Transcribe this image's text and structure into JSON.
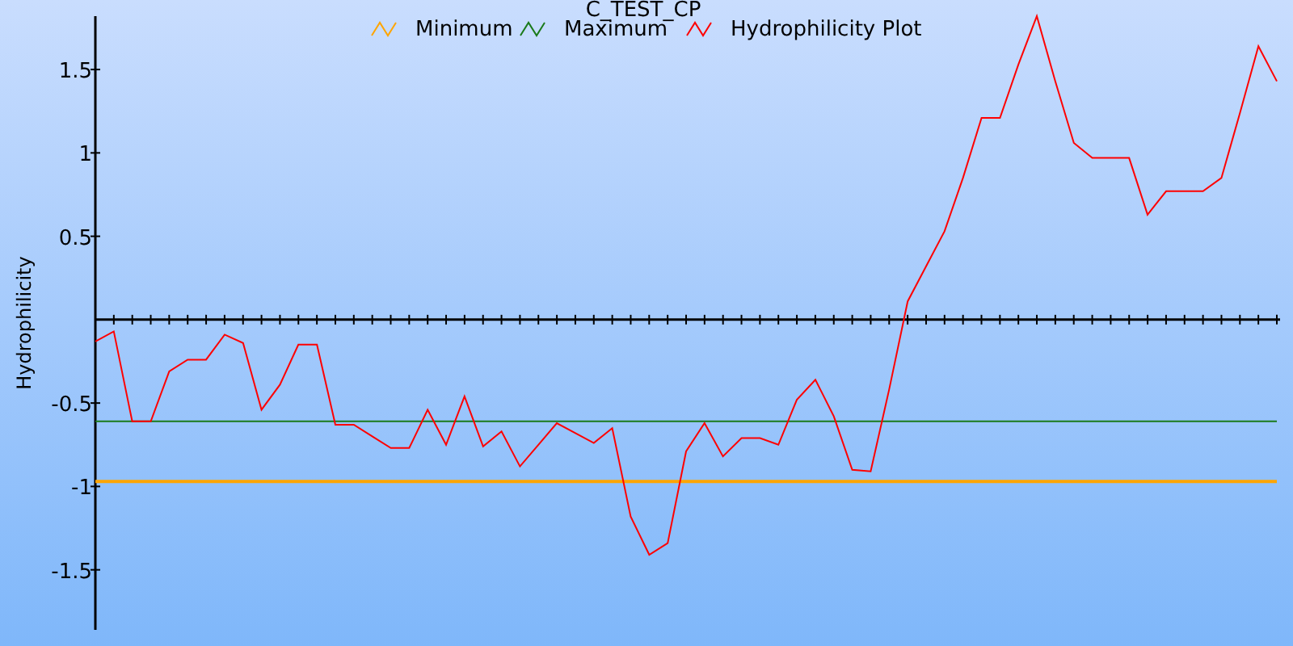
{
  "chart_data": {
    "type": "line",
    "title": "C_TEST_CP",
    "ylabel": "Hydrophilicity",
    "categories": [
      null,
      null,
      null,
      null,
      null,
      null,
      null,
      null,
      null,
      null,
      null,
      null,
      null,
      null,
      null,
      null,
      null,
      null,
      null,
      null,
      null,
      null,
      null,
      null,
      null,
      null,
      null,
      null,
      null,
      null,
      null,
      null,
      null,
      null,
      null,
      null,
      null,
      null,
      null,
      null,
      null,
      null,
      null,
      null,
      null,
      null,
      null,
      null,
      null,
      null,
      null,
      null,
      null,
      null,
      null,
      null,
      null,
      null,
      null,
      null,
      null,
      null,
      null,
      null,
      null
    ],
    "legend": "top",
    "ylim": [
      -1.86,
      1.82
    ],
    "yticks": [
      {
        "value": -1.5,
        "label": "-1.5"
      },
      {
        "value": -1,
        "label": "-1"
      },
      {
        "value": -0.5,
        "label": "-0.5"
      },
      {
        "value": 0.5,
        "label": "0.5"
      },
      {
        "value": 1,
        "label": "1"
      },
      {
        "value": 1.5,
        "label": "1.5"
      }
    ],
    "series": [
      {
        "name": "Minimum",
        "color": "#ffa500",
        "values": [
          -0.97,
          -0.97,
          -0.97,
          -0.97,
          -0.97,
          -0.97,
          -0.97,
          -0.97,
          -0.97,
          -0.97,
          -0.97,
          -0.97,
          -0.97,
          -0.97,
          -0.97,
          -0.97,
          -0.97,
          -0.97,
          -0.97,
          -0.97,
          -0.97,
          -0.97,
          -0.97,
          -0.97,
          -0.97,
          -0.97,
          -0.97,
          -0.97,
          -0.97,
          -0.97,
          -0.97,
          -0.97,
          -0.97,
          -0.97,
          -0.97,
          -0.97,
          -0.97,
          -0.97,
          -0.97,
          -0.97,
          -0.97,
          -0.97,
          -0.97,
          -0.97,
          -0.97,
          -0.97,
          -0.97,
          -0.97,
          -0.97,
          -0.97,
          -0.97,
          -0.97,
          -0.97,
          -0.97,
          -0.97,
          -0.97,
          -0.97,
          -0.97,
          -0.97,
          -0.97,
          -0.97,
          -0.97,
          -0.97,
          -0.97,
          -0.97
        ]
      },
      {
        "name": "Maximum",
        "color": "#1a7a1a",
        "values": [
          -0.61,
          -0.61,
          -0.61,
          -0.61,
          -0.61,
          -0.61,
          -0.61,
          -0.61,
          -0.61,
          -0.61,
          -0.61,
          -0.61,
          -0.61,
          -0.61,
          -0.61,
          -0.61,
          -0.61,
          -0.61,
          -0.61,
          -0.61,
          -0.61,
          -0.61,
          -0.61,
          -0.61,
          -0.61,
          -0.61,
          -0.61,
          -0.61,
          -0.61,
          -0.61,
          -0.61,
          -0.61,
          -0.61,
          -0.61,
          -0.61,
          -0.61,
          -0.61,
          -0.61,
          -0.61,
          -0.61,
          -0.61,
          -0.61,
          -0.61,
          -0.61,
          -0.61,
          -0.61,
          -0.61,
          -0.61,
          -0.61,
          -0.61,
          -0.61,
          -0.61,
          -0.61,
          -0.61,
          -0.61,
          -0.61,
          -0.61,
          -0.61,
          -0.61,
          -0.61,
          -0.61,
          -0.61,
          -0.61,
          -0.61,
          -0.61
        ]
      },
      {
        "name": "Hydrophilicity Plot",
        "color": "#ff0000",
        "values": [
          -0.13,
          -0.07,
          -0.61,
          -0.61,
          -0.31,
          -0.24,
          -0.24,
          -0.09,
          -0.14,
          -0.54,
          -0.39,
          -0.15,
          -0.15,
          -0.63,
          -0.63,
          -0.7,
          -0.77,
          -0.77,
          -0.54,
          -0.75,
          -0.46,
          -0.76,
          -0.67,
          -0.88,
          -0.75,
          -0.62,
          -0.68,
          -0.74,
          -0.65,
          -1.18,
          -1.41,
          -1.34,
          -0.79,
          -0.62,
          -0.82,
          -0.71,
          -0.71,
          -0.75,
          -0.48,
          -0.36,
          -0.58,
          -0.9,
          -0.91,
          -0.42,
          0.11,
          0.32,
          0.53,
          0.85,
          1.21,
          1.21,
          1.53,
          1.82,
          1.43,
          1.06,
          0.97,
          0.97,
          0.97,
          0.63,
          0.77,
          0.77,
          0.77,
          0.85,
          1.24,
          1.64,
          1.43
        ]
      }
    ]
  }
}
